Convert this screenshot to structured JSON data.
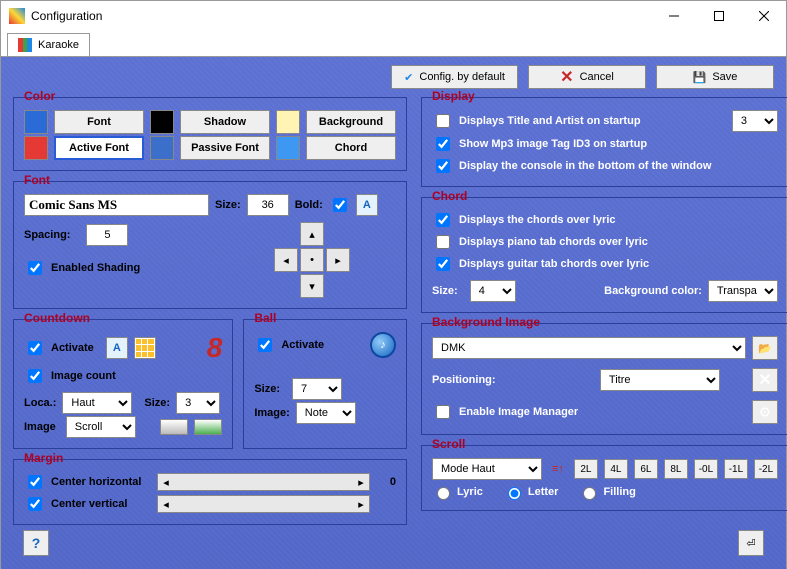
{
  "window": {
    "title": "Configuration"
  },
  "tab": {
    "label": "Karaoke"
  },
  "buttons": {
    "defaults": "Config. by default",
    "cancel": "Cancel",
    "save": "Save"
  },
  "color": {
    "legend": "Color",
    "font": "Font",
    "shadow": "Shadow",
    "background": "Background",
    "activeFont": "Active Font",
    "passiveFont": "Passive Font",
    "chord": "Chord",
    "swatches": {
      "font": "#2a6bd8",
      "shadow": "#000000",
      "background": "#fff4b3",
      "activeFont": "#e53935",
      "passiveFont": "#3b6fc9",
      "chord": "#3e97f2"
    }
  },
  "font": {
    "legend": "Font",
    "name": "Comic Sans MS",
    "sizeLabel": "Size:",
    "size": "36",
    "boldLabel": "Bold:",
    "bold": true,
    "spacingLabel": "Spacing:",
    "spacing": "5",
    "shadingLabel": "Enabled Shading",
    "shading": true
  },
  "countdown": {
    "legend": "Countdown",
    "activateLabel": "Activate",
    "activate": true,
    "imageCountLabel": "Image count",
    "imageCount": true,
    "glyph": "8",
    "locaLabel": "Loca.:",
    "loca": "Haut",
    "sizeLabel": "Size:",
    "size": "3",
    "imageLabel": "Image",
    "image": "Scroll"
  },
  "ball": {
    "legend": "Ball",
    "activateLabel": "Activate",
    "activate": true,
    "sizeLabel": "Size:",
    "size": "7",
    "imageLabel": "Image:",
    "image": "Note"
  },
  "margin": {
    "legend": "Margin",
    "chLabel": "Center horizontal",
    "ch": true,
    "chVal": "0",
    "cvLabel": "Center vertical",
    "cv": true
  },
  "display": {
    "legend": "Display",
    "opt1": "Displays Title and Artist on startup",
    "opt1v": false,
    "opt1num": "3",
    "opt2": "Show Mp3 image Tag ID3 on startup",
    "opt2v": true,
    "opt3": "Display the console in the bottom of the window",
    "opt3v": true
  },
  "chord": {
    "legend": "Chord",
    "c1": "Displays the chords over lyric",
    "c1v": true,
    "c2": "Displays piano tab chords over lyric",
    "c2v": false,
    "c3": "Displays guitar tab chords over lyric",
    "c3v": true,
    "sizeLabel": "Size:",
    "size": "4",
    "bgLabel": "Background color:",
    "bg": "Transpare"
  },
  "bgimg": {
    "legend": "Background Image",
    "path": "DMK",
    "posLabel": "Positioning:",
    "pos": "Titre",
    "enableLabel": "Enable Image Manager",
    "enable": false
  },
  "scroll": {
    "legend": "Scroll",
    "mode": "Mode Haut",
    "btns": [
      "2L",
      "4L",
      "6L",
      "8L",
      "-0L",
      "-1L",
      "-2L"
    ],
    "r1": "Lyric",
    "r2": "Letter",
    "r3": "Filling",
    "sel": "Letter"
  }
}
